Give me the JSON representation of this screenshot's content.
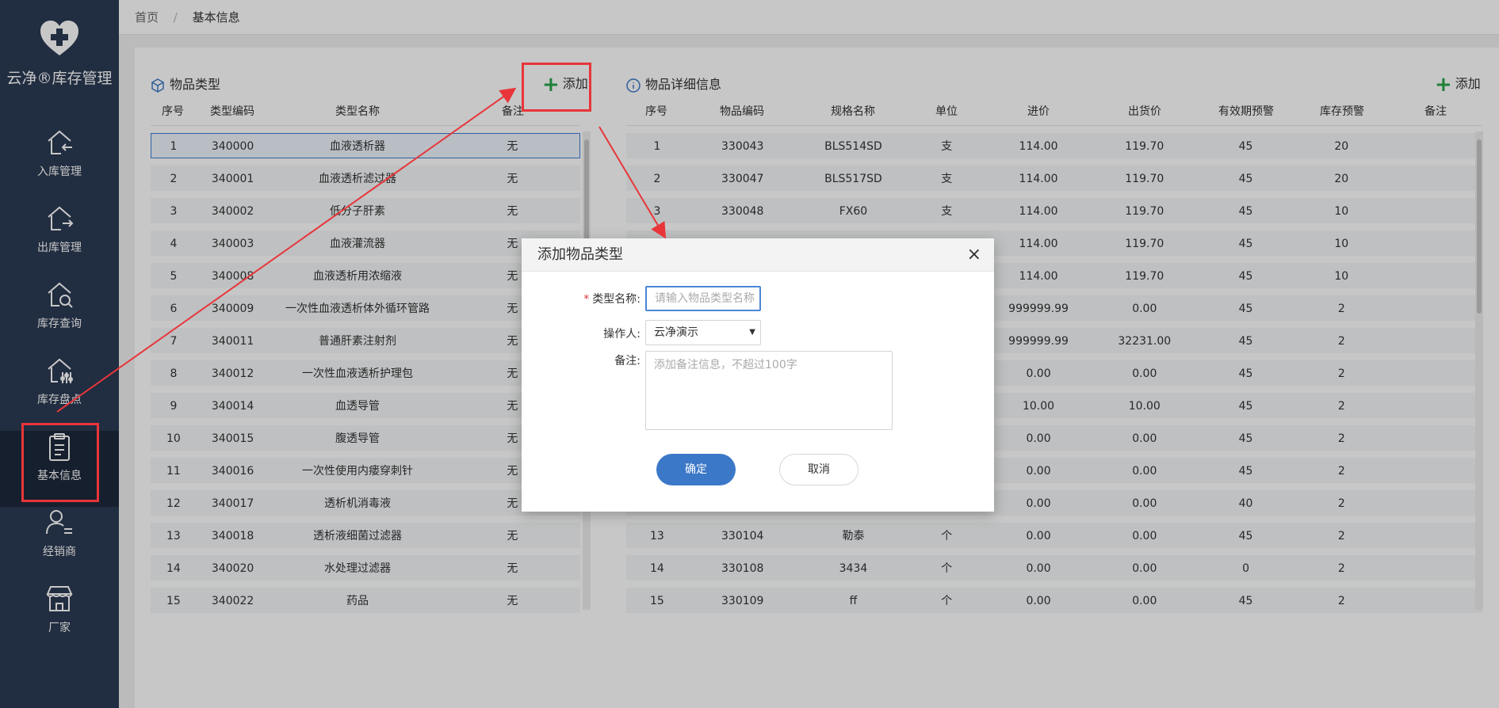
{
  "app": {
    "title": "云净®库存管理",
    "accent": "#2b3a52",
    "highlight": "#e8353a"
  },
  "sidebar": {
    "items": [
      {
        "label": "入库管理",
        "icon": "inbound-house-icon"
      },
      {
        "label": "出库管理",
        "icon": "outbound-house-icon"
      },
      {
        "label": "库存查询",
        "icon": "inventory-search-icon"
      },
      {
        "label": "库存盘点",
        "icon": "inventory-check-icon"
      },
      {
        "label": "基本信息",
        "icon": "clipboard-icon",
        "active": true
      },
      {
        "label": "经销商",
        "icon": "dealer-icon"
      },
      {
        "label": "厂家",
        "icon": "factory-store-icon"
      }
    ]
  },
  "breadcrumb": {
    "home": "首页",
    "separator": "/",
    "current": "基本信息"
  },
  "left_panel": {
    "title": "物品类型",
    "add_label": "添加",
    "columns": [
      "序号",
      "类型编码",
      "类型名称",
      "备注"
    ],
    "rows": [
      [
        "1",
        "340000",
        "血液透析器",
        "无"
      ],
      [
        "2",
        "340001",
        "血液透析滤过器",
        "无"
      ],
      [
        "3",
        "340002",
        "低分子肝素",
        "无"
      ],
      [
        "4",
        "340003",
        "血液灌流器",
        "无"
      ],
      [
        "5",
        "340008",
        "血液透析用浓缩液",
        "无"
      ],
      [
        "6",
        "340009",
        "一次性血液透析体外循环管路",
        "无"
      ],
      [
        "7",
        "340011",
        "普通肝素注射剂",
        "无"
      ],
      [
        "8",
        "340012",
        "一次性血液透析护理包",
        "无"
      ],
      [
        "9",
        "340014",
        "血透导管",
        "无"
      ],
      [
        "10",
        "340015",
        "腹透导管",
        "无"
      ],
      [
        "11",
        "340016",
        "一次性使用内瘘穿刺针",
        "无"
      ],
      [
        "12",
        "340017",
        "透析机消毒液",
        "无"
      ],
      [
        "13",
        "340018",
        "透析液细菌过滤器",
        "无"
      ],
      [
        "14",
        "340020",
        "水处理过滤器",
        "无"
      ],
      [
        "15",
        "340022",
        "药品",
        "无"
      ]
    ]
  },
  "right_panel": {
    "title": "物品详细信息",
    "add_label": "添加",
    "columns": [
      "序号",
      "物品编码",
      "规格名称",
      "单位",
      "进价",
      "出货价",
      "有效期预警",
      "库存预警",
      "备注"
    ],
    "rows": [
      [
        "1",
        "330043",
        "BLS514SD",
        "支",
        "114.00",
        "119.70",
        "45",
        "20",
        ""
      ],
      [
        "2",
        "330047",
        "BLS517SD",
        "支",
        "114.00",
        "119.70",
        "45",
        "20",
        ""
      ],
      [
        "3",
        "330048",
        "FX60",
        "支",
        "114.00",
        "119.70",
        "45",
        "10",
        ""
      ],
      [
        "4",
        "",
        "",
        "",
        "114.00",
        "119.70",
        "45",
        "10",
        ""
      ],
      [
        "5",
        "",
        "",
        "",
        "114.00",
        "119.70",
        "45",
        "10",
        ""
      ],
      [
        "6",
        "",
        "",
        "",
        "999999.99",
        "0.00",
        "45",
        "2",
        ""
      ],
      [
        "7",
        "",
        "",
        "",
        "999999.99",
        "32231.00",
        "45",
        "2",
        ""
      ],
      [
        "8",
        "",
        "",
        "",
        "0.00",
        "0.00",
        "45",
        "2",
        ""
      ],
      [
        "9",
        "",
        "",
        "",
        "10.00",
        "10.00",
        "45",
        "2",
        ""
      ],
      [
        "10",
        "",
        "",
        "",
        "0.00",
        "0.00",
        "45",
        "2",
        ""
      ],
      [
        "11",
        "",
        "",
        "",
        "0.00",
        "0.00",
        "45",
        "2",
        ""
      ],
      [
        "12",
        "",
        "",
        "",
        "0.00",
        "0.00",
        "40",
        "2",
        ""
      ],
      [
        "13",
        "330104",
        "勒泰",
        "个",
        "0.00",
        "0.00",
        "45",
        "2",
        ""
      ],
      [
        "14",
        "330108",
        "3434",
        "个",
        "0.00",
        "0.00",
        "0",
        "2",
        ""
      ],
      [
        "15",
        "330109",
        "ff",
        "个",
        "0.00",
        "0.00",
        "45",
        "2",
        ""
      ]
    ]
  },
  "dialog": {
    "title": "添加物品类型",
    "close": "×",
    "type_name_label": "类型名称:",
    "required_mark": "*",
    "type_name_placeholder": "请输入物品类型名称",
    "operator_label": "操作人:",
    "operator_value": "云净演示",
    "remark_label": "备注:",
    "remark_placeholder": "添加备注信息，不超过100字",
    "ok": "确定",
    "cancel": "取消"
  }
}
